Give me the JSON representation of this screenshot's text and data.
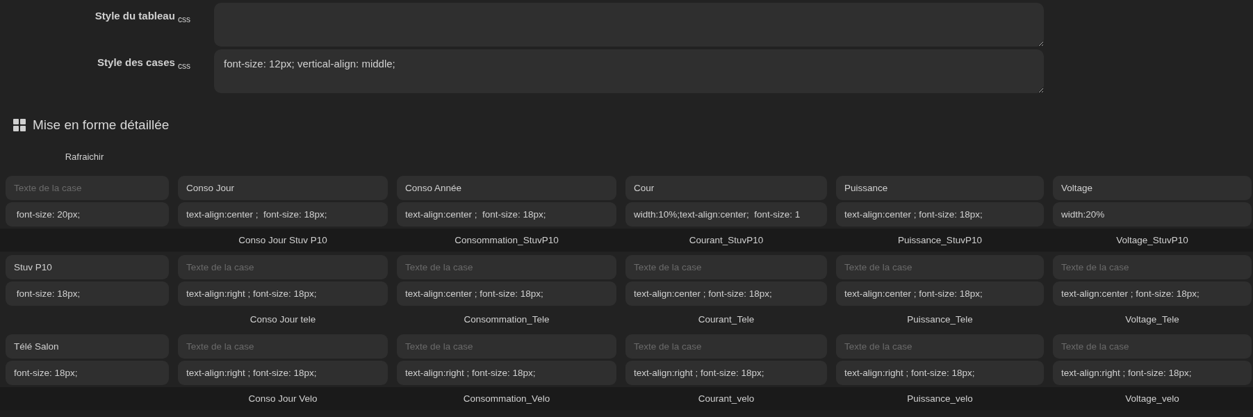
{
  "styles": [
    {
      "label": "Style du tableau $_{css}$"
    },
    {
      "label": "Style des cases $_{css}$",
      "value": "font-size: 12px; vertical-align: middle;"
    }
  ],
  "detail": {
    "title": "Mise en forme détaillée",
    "refresh_label": "Rafraichir",
    "header": {
      "cells": [
        {
          "placeholder": "Texte de la case",
          "style": " font-size: 20px;"
        },
        {
          "text": "Conso Jour",
          "style": "text-align:center ;  font-size: 18px;"
        },
        {
          "text": "Conso Année",
          "style": "text-align:center ;  font-size: 18px;"
        },
        {
          "text": "Cour",
          "style": "width:10%;text-align:center;  font-size: 1"
        },
        {
          "text": "Puissance",
          "style": "text-align:center ; font-size: 18px;"
        },
        {
          "text": "Voltage",
          "style": "width:20%"
        }
      ]
    },
    "rows": [
      {
        "bindings": [
          "Conso Jour Stuv P10",
          "Consommation_StuvP10",
          "Courant_StuvP10",
          "Puissance_StuvP10",
          "Voltage_StuvP10"
        ],
        "cells": [
          {
            "text": "Stuv P10",
            "style": " font-size: 18px;"
          },
          {
            "placeholder": "Texte de la case",
            "style": "text-align:right ; font-size: 18px;"
          },
          {
            "placeholder": "Texte de la case",
            "style": "text-align:center ; font-size: 18px;"
          },
          {
            "placeholder": "Texte de la case",
            "style": "text-align:center ; font-size: 18px;"
          },
          {
            "placeholder": "Texte de la case",
            "style": "text-align:center ; font-size: 18px;"
          },
          {
            "placeholder": "Texte de la case",
            "style": "text-align:center ; font-size: 18px;"
          }
        ]
      },
      {
        "bindings": [
          "Conso Jour tele",
          "Consommation_Tele",
          "Courant_Tele",
          "Puissance_Tele",
          "Voltage_Tele"
        ],
        "cells": [
          {
            "text": "Télé Salon",
            "style": "font-size: 18px;"
          },
          {
            "placeholder": "Texte de la case",
            "style": "text-align:right ; font-size: 18px;"
          },
          {
            "placeholder": "Texte de la case",
            "style": "text-align:right ; font-size: 18px;"
          },
          {
            "placeholder": "Texte de la case",
            "style": "text-align:right ; font-size: 18px;"
          },
          {
            "placeholder": "Texte de la case",
            "style": "text-align:right ; font-size: 18px;"
          },
          {
            "placeholder": "Texte de la case",
            "style": "text-align:right ; font-size: 18px;"
          }
        ]
      },
      {
        "bindings": [
          "Conso Jour Velo",
          "Consommation_Velo",
          "Courant_velo",
          "Puissance_velo",
          "Voltage_velo"
        ]
      }
    ]
  }
}
